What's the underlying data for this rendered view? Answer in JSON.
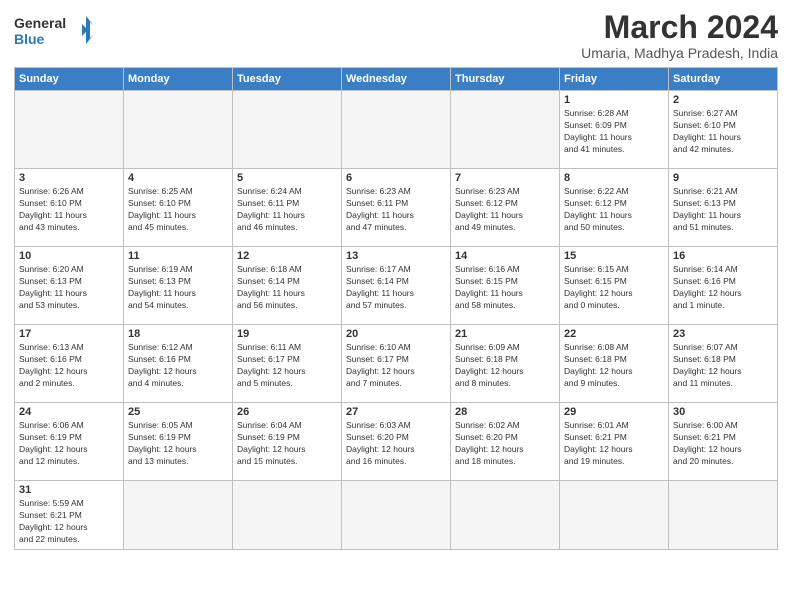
{
  "header": {
    "logo_general": "General",
    "logo_blue": "Blue",
    "month_year": "March 2024",
    "subtitle": "Umaria, Madhya Pradesh, India"
  },
  "days_of_week": [
    "Sunday",
    "Monday",
    "Tuesday",
    "Wednesday",
    "Thursday",
    "Friday",
    "Saturday"
  ],
  "weeks": [
    [
      {
        "day": "",
        "info": ""
      },
      {
        "day": "",
        "info": ""
      },
      {
        "day": "",
        "info": ""
      },
      {
        "day": "",
        "info": ""
      },
      {
        "day": "",
        "info": ""
      },
      {
        "day": "1",
        "info": "Sunrise: 6:28 AM\nSunset: 6:09 PM\nDaylight: 11 hours\nand 41 minutes."
      },
      {
        "day": "2",
        "info": "Sunrise: 6:27 AM\nSunset: 6:10 PM\nDaylight: 11 hours\nand 42 minutes."
      }
    ],
    [
      {
        "day": "3",
        "info": "Sunrise: 6:26 AM\nSunset: 6:10 PM\nDaylight: 11 hours\nand 43 minutes."
      },
      {
        "day": "4",
        "info": "Sunrise: 6:25 AM\nSunset: 6:10 PM\nDaylight: 11 hours\nand 45 minutes."
      },
      {
        "day": "5",
        "info": "Sunrise: 6:24 AM\nSunset: 6:11 PM\nDaylight: 11 hours\nand 46 minutes."
      },
      {
        "day": "6",
        "info": "Sunrise: 6:23 AM\nSunset: 6:11 PM\nDaylight: 11 hours\nand 47 minutes."
      },
      {
        "day": "7",
        "info": "Sunrise: 6:23 AM\nSunset: 6:12 PM\nDaylight: 11 hours\nand 49 minutes."
      },
      {
        "day": "8",
        "info": "Sunrise: 6:22 AM\nSunset: 6:12 PM\nDaylight: 11 hours\nand 50 minutes."
      },
      {
        "day": "9",
        "info": "Sunrise: 6:21 AM\nSunset: 6:13 PM\nDaylight: 11 hours\nand 51 minutes."
      }
    ],
    [
      {
        "day": "10",
        "info": "Sunrise: 6:20 AM\nSunset: 6:13 PM\nDaylight: 11 hours\nand 53 minutes."
      },
      {
        "day": "11",
        "info": "Sunrise: 6:19 AM\nSunset: 6:13 PM\nDaylight: 11 hours\nand 54 minutes."
      },
      {
        "day": "12",
        "info": "Sunrise: 6:18 AM\nSunset: 6:14 PM\nDaylight: 11 hours\nand 56 minutes."
      },
      {
        "day": "13",
        "info": "Sunrise: 6:17 AM\nSunset: 6:14 PM\nDaylight: 11 hours\nand 57 minutes."
      },
      {
        "day": "14",
        "info": "Sunrise: 6:16 AM\nSunset: 6:15 PM\nDaylight: 11 hours\nand 58 minutes."
      },
      {
        "day": "15",
        "info": "Sunrise: 6:15 AM\nSunset: 6:15 PM\nDaylight: 12 hours\nand 0 minutes."
      },
      {
        "day": "16",
        "info": "Sunrise: 6:14 AM\nSunset: 6:16 PM\nDaylight: 12 hours\nand 1 minute."
      }
    ],
    [
      {
        "day": "17",
        "info": "Sunrise: 6:13 AM\nSunset: 6:16 PM\nDaylight: 12 hours\nand 2 minutes."
      },
      {
        "day": "18",
        "info": "Sunrise: 6:12 AM\nSunset: 6:16 PM\nDaylight: 12 hours\nand 4 minutes."
      },
      {
        "day": "19",
        "info": "Sunrise: 6:11 AM\nSunset: 6:17 PM\nDaylight: 12 hours\nand 5 minutes."
      },
      {
        "day": "20",
        "info": "Sunrise: 6:10 AM\nSunset: 6:17 PM\nDaylight: 12 hours\nand 7 minutes."
      },
      {
        "day": "21",
        "info": "Sunrise: 6:09 AM\nSunset: 6:18 PM\nDaylight: 12 hours\nand 8 minutes."
      },
      {
        "day": "22",
        "info": "Sunrise: 6:08 AM\nSunset: 6:18 PM\nDaylight: 12 hours\nand 9 minutes."
      },
      {
        "day": "23",
        "info": "Sunrise: 6:07 AM\nSunset: 6:18 PM\nDaylight: 12 hours\nand 11 minutes."
      }
    ],
    [
      {
        "day": "24",
        "info": "Sunrise: 6:06 AM\nSunset: 6:19 PM\nDaylight: 12 hours\nand 12 minutes."
      },
      {
        "day": "25",
        "info": "Sunrise: 6:05 AM\nSunset: 6:19 PM\nDaylight: 12 hours\nand 13 minutes."
      },
      {
        "day": "26",
        "info": "Sunrise: 6:04 AM\nSunset: 6:19 PM\nDaylight: 12 hours\nand 15 minutes."
      },
      {
        "day": "27",
        "info": "Sunrise: 6:03 AM\nSunset: 6:20 PM\nDaylight: 12 hours\nand 16 minutes."
      },
      {
        "day": "28",
        "info": "Sunrise: 6:02 AM\nSunset: 6:20 PM\nDaylight: 12 hours\nand 18 minutes."
      },
      {
        "day": "29",
        "info": "Sunrise: 6:01 AM\nSunset: 6:21 PM\nDaylight: 12 hours\nand 19 minutes."
      },
      {
        "day": "30",
        "info": "Sunrise: 6:00 AM\nSunset: 6:21 PM\nDaylight: 12 hours\nand 20 minutes."
      }
    ],
    [
      {
        "day": "31",
        "info": "Sunrise: 5:59 AM\nSunset: 6:21 PM\nDaylight: 12 hours\nand 22 minutes."
      },
      {
        "day": "",
        "info": ""
      },
      {
        "day": "",
        "info": ""
      },
      {
        "day": "",
        "info": ""
      },
      {
        "day": "",
        "info": ""
      },
      {
        "day": "",
        "info": ""
      },
      {
        "day": "",
        "info": ""
      }
    ]
  ]
}
